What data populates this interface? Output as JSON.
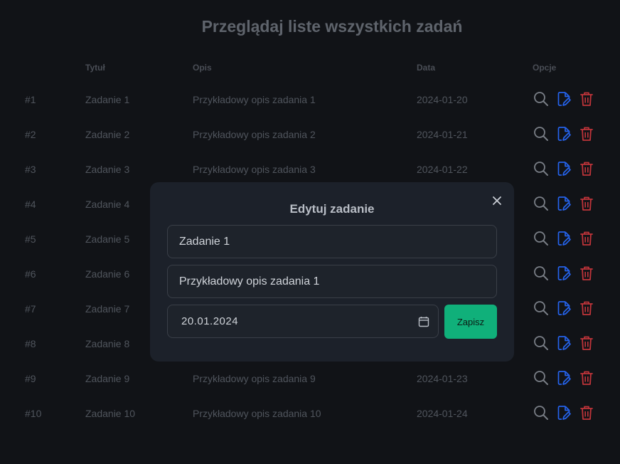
{
  "page": {
    "title": "Przeglądaj liste wszystkich zadań"
  },
  "table": {
    "headers": {
      "id": "",
      "title": "Tytuł",
      "description": "Opis",
      "date": "Data",
      "options": "Opcje"
    },
    "rows": [
      {
        "id": "#1",
        "title": "Zadanie 1",
        "description": "Przykładowy opis zadania 1",
        "date": "2024-01-20"
      },
      {
        "id": "#2",
        "title": "Zadanie 2",
        "description": "Przykładowy opis zadania 2",
        "date": "2024-01-21"
      },
      {
        "id": "#3",
        "title": "Zadanie 3",
        "description": "Przykładowy opis zadania 3",
        "date": "2024-01-22"
      },
      {
        "id": "#4",
        "title": "Zadanie 4",
        "description": "",
        "date": ""
      },
      {
        "id": "#5",
        "title": "Zadanie 5",
        "description": "",
        "date": ""
      },
      {
        "id": "#6",
        "title": "Zadanie 6",
        "description": "",
        "date": ""
      },
      {
        "id": "#7",
        "title": "Zadanie 7",
        "description": "",
        "date": ""
      },
      {
        "id": "#8",
        "title": "Zadanie 8",
        "description": "",
        "date": ""
      },
      {
        "id": "#9",
        "title": "Zadanie 9",
        "description": "Przykładowy opis zadania 9",
        "date": "2024-01-23"
      },
      {
        "id": "#10",
        "title": "Zadanie 10",
        "description": "Przykładowy opis zadania 10",
        "date": "2024-01-24"
      }
    ],
    "option_icons": [
      "search-icon",
      "edit-file-icon",
      "trash-icon"
    ]
  },
  "modal": {
    "title": "Edytuj zadanie",
    "title_field_value": "Zadanie 1",
    "description_field_value": "Przykładowy opis zadania 1",
    "date_value": "20.01.2024",
    "save_label": "Zapisz",
    "close_icon": "close-icon",
    "calendar_icon": "calendar-icon"
  },
  "colors": {
    "background": "#111317",
    "modal_background": "#1c212a",
    "save_button": "#10b07a",
    "search_icon": "#7a7f87",
    "edit_icon": "#2563eb",
    "trash_icon": "#c0343a"
  }
}
